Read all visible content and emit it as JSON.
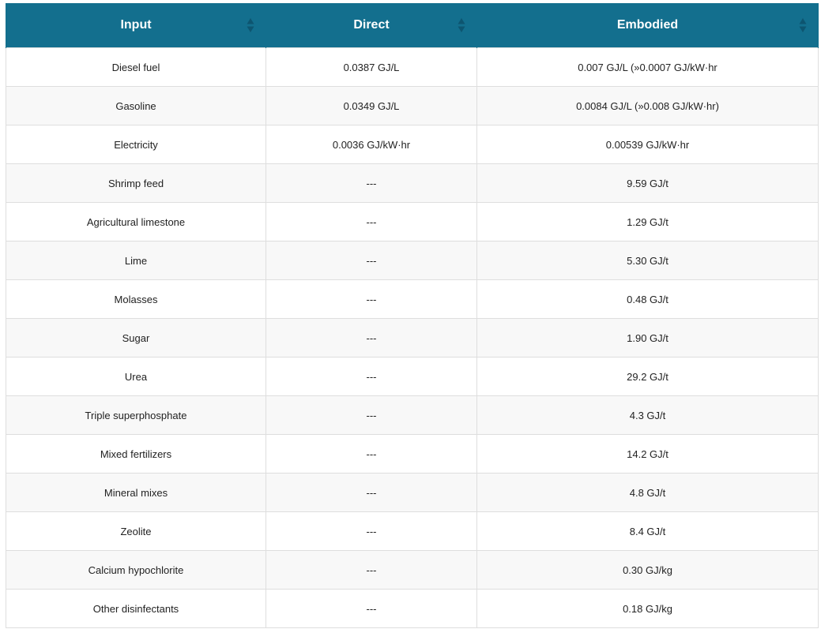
{
  "table": {
    "headers": [
      {
        "label": "Input",
        "sort_icon": "sort-icon"
      },
      {
        "label": "Direct",
        "sort_icon": "sort-icon"
      },
      {
        "label": "Embodied",
        "sort_icon": "sort-icon"
      }
    ],
    "header_color": "#136f8e",
    "rows": [
      {
        "input": "Diesel fuel",
        "direct": "0.0387 GJ/L",
        "embodied": "0.007 GJ/L (»0.0007 GJ/kW·hr"
      },
      {
        "input": "Gasoline",
        "direct": "0.0349 GJ/L",
        "embodied": "0.0084 GJ/L (»0.008 GJ/kW·hr)"
      },
      {
        "input": "Electricity",
        "direct": "0.0036 GJ/kW·hr",
        "embodied": "0.00539 GJ/kW·hr"
      },
      {
        "input": "Shrimp feed",
        "direct": "---",
        "embodied": "9.59 GJ/t"
      },
      {
        "input": "Agricultural limestone",
        "direct": "---",
        "embodied": "1.29 GJ/t"
      },
      {
        "input": "Lime",
        "direct": "---",
        "embodied": "5.30 GJ/t"
      },
      {
        "input": "Molasses",
        "direct": "---",
        "embodied": "0.48 GJ/t"
      },
      {
        "input": "Sugar",
        "direct": "---",
        "embodied": "1.90 GJ/t"
      },
      {
        "input": "Urea",
        "direct": "---",
        "embodied": "29.2 GJ/t"
      },
      {
        "input": "Triple superphosphate",
        "direct": "---",
        "embodied": "4.3 GJ/t"
      },
      {
        "input": "Mixed fertilizers",
        "direct": "---",
        "embodied": "14.2 GJ/t"
      },
      {
        "input": "Mineral mixes",
        "direct": "---",
        "embodied": "4.8 GJ/t"
      },
      {
        "input": "Zeolite",
        "direct": "---",
        "embodied": "8.4 GJ/t"
      },
      {
        "input": "Calcium hypochlorite",
        "direct": "---",
        "embodied": "0.30 GJ/kg"
      },
      {
        "input": "Other disinfectants",
        "direct": "---",
        "embodied": "0.18 GJ/kg"
      }
    ]
  }
}
